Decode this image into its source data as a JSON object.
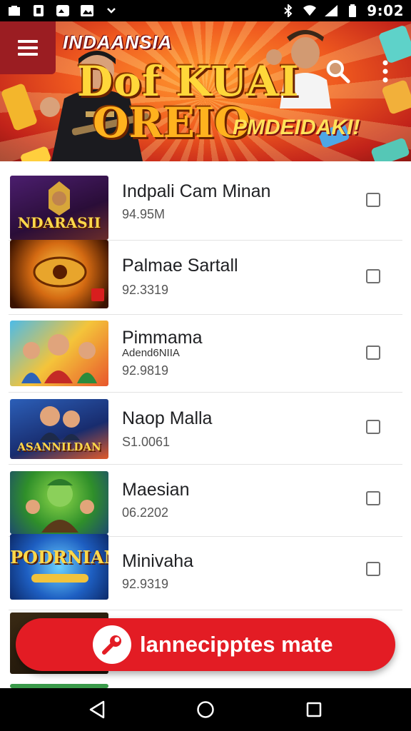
{
  "status_bar": {
    "time": "9:02",
    "left_icons": [
      "app-icon",
      "sim-icon",
      "mail-icon",
      "image-icon",
      "chevron-down-icon"
    ],
    "right_icons": [
      "bluetooth-icon",
      "wifi-icon",
      "signal-icon",
      "battery-icon"
    ]
  },
  "banner": {
    "subtitle": "INDAANSIA",
    "title_line1": "Dof KUAI",
    "title_line2": "OREIO",
    "tagline": "PMDEIDAKI!",
    "icons": {
      "menu": "hamburger-menu-icon",
      "search": "search-icon",
      "more": "more-vert-icon"
    }
  },
  "list": {
    "items": [
      {
        "title": "Indpali Cam Minan",
        "price": "94.95M",
        "thumb_text": "NDARASII",
        "checked": false
      },
      {
        "title": "Palmae Sartall",
        "price": "92.3319",
        "thumb_text": "",
        "checked": false
      },
      {
        "title": "Pimmama",
        "subtitle": "Adend6NIIA",
        "price": "92.9819",
        "thumb_text": "",
        "checked": false
      },
      {
        "title": "Naop Malla",
        "price": "S1.0061",
        "thumb_text": "ASANNILDAN",
        "checked": false
      },
      {
        "title": "Maesian",
        "price": "06.2202",
        "thumb_text": "",
        "checked": false
      },
      {
        "title": "Minivaha",
        "price": "92.9319",
        "thumb_text": "PODRNIAN",
        "checked": false
      }
    ]
  },
  "cta": {
    "label": "lannecipptes mate",
    "icon": "wrench-icon"
  },
  "nav_bar": {
    "icons": [
      "back-icon",
      "home-icon",
      "recents-icon"
    ]
  },
  "colors": {
    "accent_red": "#e31c24",
    "menu_red": "#9b1d22",
    "status_bg": "#000000"
  }
}
